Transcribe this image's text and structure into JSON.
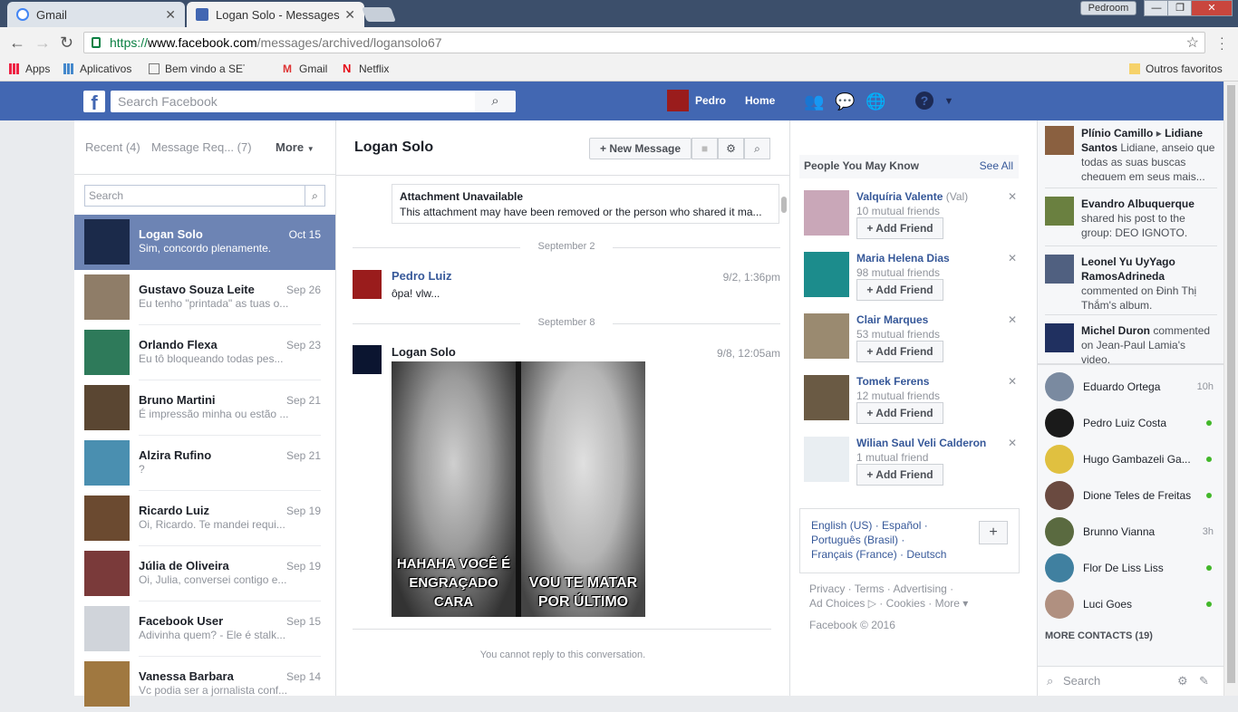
{
  "browser": {
    "tabs": [
      {
        "label": "Gmail",
        "active": false
      },
      {
        "label": "Logan Solo - Messages",
        "active": true
      }
    ],
    "profile": "Pedroom",
    "url": {
      "protocol": "https://",
      "domain": "www.facebook.com",
      "path": "/messages/archived/logansolo67"
    },
    "bookmarks": [
      "Apps",
      "Aplicativos",
      "Bem vindo a SETI@ho",
      "Gmail",
      "Netflix"
    ],
    "other_bookmarks": "Outros favoritos"
  },
  "fb": {
    "search_placeholder": "Search Facebook",
    "user": "Pedro",
    "home": "Home"
  },
  "inbox": {
    "recent": "Recent",
    "recent_count": "(4)",
    "requests": "Message Req...",
    "requests_count": "(7)",
    "more": "More",
    "search_placeholder": "Search",
    "threads": [
      {
        "name": "Logan Solo",
        "date": "Oct 15",
        "snippet": "Sim, concordo plenamente.",
        "active": true,
        "color": "#1b2a4a"
      },
      {
        "name": "Gustavo Souza Leite",
        "date": "Sep 26",
        "snippet": "Eu tenho \"printada\" as tuas o...",
        "color": "#8f7d68"
      },
      {
        "name": "Orlando Flexa",
        "date": "Sep 23",
        "snippet": "Eu tô bloqueando todas pes...",
        "color": "#2e7a5a"
      },
      {
        "name": "Bruno Martini",
        "date": "Sep 21",
        "snippet": "É impressão minha ou estão ...",
        "color": "#5a4632"
      },
      {
        "name": "Alzira Rufino",
        "date": "Sep 21",
        "snippet": "?",
        "color": "#4a8fb0"
      },
      {
        "name": "Ricardo Luiz",
        "date": "Sep 19",
        "snippet": "Oi, Ricardo. Te mandei requi...",
        "color": "#6b4a30"
      },
      {
        "name": "Júlia de Oliveira",
        "date": "Sep 19",
        "snippet": "Oi, Julia, conversei contigo e...",
        "color": "#7a3a3a"
      },
      {
        "name": "Facebook User",
        "date": "Sep 15",
        "snippet": "Adivinha quem? - Ele é stalk...",
        "color": "#d0d4da"
      },
      {
        "name": "Vanessa Barbara",
        "date": "Sep 14",
        "snippet": "Vc podia ser a jornalista conf...",
        "color": "#a07840"
      }
    ]
  },
  "conversation": {
    "title": "Logan Solo",
    "new_message": "New Message",
    "attachment_title": "Attachment Unavailable",
    "attachment_desc": "This attachment may have been removed or the person who shared it ma...",
    "date1": "September 2",
    "msg1": {
      "name": "Pedro Luiz",
      "time": "9/2, 1:36pm",
      "text": "ôpa! vlw..."
    },
    "date2": "September 8",
    "msg2": {
      "name": "Logan Solo",
      "time": "9/8, 12:05am"
    },
    "meme_left": "HAHAHA VOCÊ É ENGRAÇADO CARA",
    "meme_right": "VOU TE MATAR POR ÚLTIMO",
    "no_reply": "You cannot reply to this conversation."
  },
  "pymk": {
    "title": "People You May Know",
    "see_all": "See All",
    "add_label": "Add Friend",
    "people": [
      {
        "name": "Valquíria Valente",
        "alt": "(Val)",
        "mutual": "10 mutual friends",
        "color": "#c9a7b8"
      },
      {
        "name": "Maria Helena Dias",
        "alt": "",
        "mutual": "98 mutual friends",
        "color": "#1c8c8c"
      },
      {
        "name": "Clair Marques",
        "alt": "",
        "mutual": "53 mutual friends",
        "color": "#9a8a70"
      },
      {
        "name": "Tomek Ferens",
        "alt": "",
        "mutual": "12 mutual friends",
        "color": "#6a5a44"
      },
      {
        "name": "Wilian Saul Veli Calderon",
        "alt": "",
        "mutual": "1 mutual friend",
        "color": "#e9eef2"
      }
    ]
  },
  "languages": {
    "line1": "English (US) · Español ·",
    "line2": "Português (Brasil) ·",
    "line3": "Français (France) · Deutsch"
  },
  "footer": {
    "line1": "Privacy · Terms · Advertising ·",
    "line2": "Ad Choices ▷ · Cookies · More ▾",
    "copyright": "Facebook © 2016"
  },
  "ticker": [
    {
      "html_name": "Plínio Camillo",
      "target": "Lidiane Santos",
      "text": "Lidiane, anseio que todas as suas buscas cheguem em seus mais...",
      "color": "#8a6040"
    },
    {
      "html_name": "Evandro Albuquerque",
      "target": "",
      "text": "shared his post to the group: DEO IGNOTO.",
      "color": "#6a8040"
    },
    {
      "html_name": "Leonel Yu UyYago RamosAdrineda",
      "target": "",
      "text": "commented on Đinh Thị Thắm's album.",
      "color": "#506080"
    },
    {
      "html_name": "Michel Duron",
      "target": "",
      "text": "commented on Jean-Paul Lamia's video.",
      "color": "#203060"
    }
  ],
  "contacts": [
    {
      "name": "Eduardo Ortega",
      "status": "10h",
      "color": "#7a8aa0"
    },
    {
      "name": "Pedro Luiz Costa",
      "status": "online",
      "color": "#1a1a1a"
    },
    {
      "name": "Hugo Gambazeli Ga...",
      "status": "online",
      "color": "#e0c040"
    },
    {
      "name": "Dione Teles de Freitas",
      "status": "online",
      "color": "#6a4a40"
    },
    {
      "name": "Brunno Vianna",
      "status": "3h",
      "color": "#5a6a40"
    },
    {
      "name": "Flor De Liss Liss",
      "status": "online",
      "color": "#4080a0"
    },
    {
      "name": "Luci Goes",
      "status": "online",
      "color": "#b09080"
    }
  ],
  "more_contacts": "MORE CONTACTS (19)",
  "chat_search": "Search"
}
